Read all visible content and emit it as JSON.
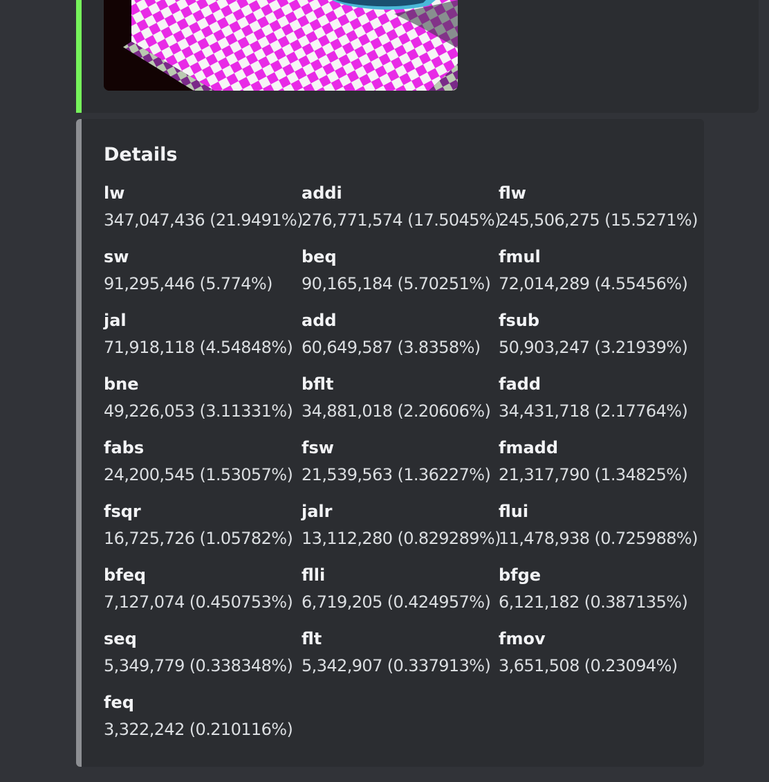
{
  "accent_colors": {
    "top_embed_border": "#76f35b",
    "details_embed_border": "#8d8f93",
    "embed_background": "#2b2d31",
    "page_background": "#313338"
  },
  "preview_image": {
    "icon": "rendered-scene-image"
  },
  "details": {
    "title": "Details",
    "fields": [
      {
        "name": "lw",
        "value": "347,047,436 (21.9491%)"
      },
      {
        "name": "addi",
        "value": "276,771,574 (17.5045%)"
      },
      {
        "name": "flw",
        "value": "245,506,275 (15.5271%)"
      },
      {
        "name": "sw",
        "value": "91,295,446 (5.774%)"
      },
      {
        "name": "beq",
        "value": "90,165,184 (5.70251%)"
      },
      {
        "name": "fmul",
        "value": "72,014,289 (4.55456%)"
      },
      {
        "name": "jal",
        "value": "71,918,118 (4.54848%)"
      },
      {
        "name": "add",
        "value": "60,649,587 (3.8358%)"
      },
      {
        "name": "fsub",
        "value": "50,903,247 (3.21939%)"
      },
      {
        "name": "bne",
        "value": "49,226,053 (3.11331%)"
      },
      {
        "name": "bflt",
        "value": "34,881,018 (2.20606%)"
      },
      {
        "name": "fadd",
        "value": "34,431,718 (2.17764%)"
      },
      {
        "name": "fabs",
        "value": "24,200,545 (1.53057%)"
      },
      {
        "name": "fsw",
        "value": "21,539,563 (1.36227%)"
      },
      {
        "name": "fmadd",
        "value": "21,317,790 (1.34825%)"
      },
      {
        "name": "fsqr",
        "value": "16,725,726 (1.05782%)"
      },
      {
        "name": "jalr",
        "value": "13,112,280 (0.829289%)"
      },
      {
        "name": "flui",
        "value": "11,478,938 (0.725988%)"
      },
      {
        "name": "bfeq",
        "value": "7,127,074 (0.450753%)"
      },
      {
        "name": "flli",
        "value": "6,719,205 (0.424957%)"
      },
      {
        "name": "bfge",
        "value": "6,121,182 (0.387135%)"
      },
      {
        "name": "seq",
        "value": "5,349,779 (0.338348%)"
      },
      {
        "name": "flt",
        "value": "5,342,907 (0.337913%)"
      },
      {
        "name": "fmov",
        "value": "3,651,508 (0.23094%)"
      },
      {
        "name": "feq",
        "value": "3,322,242 (0.210116%)"
      }
    ]
  }
}
